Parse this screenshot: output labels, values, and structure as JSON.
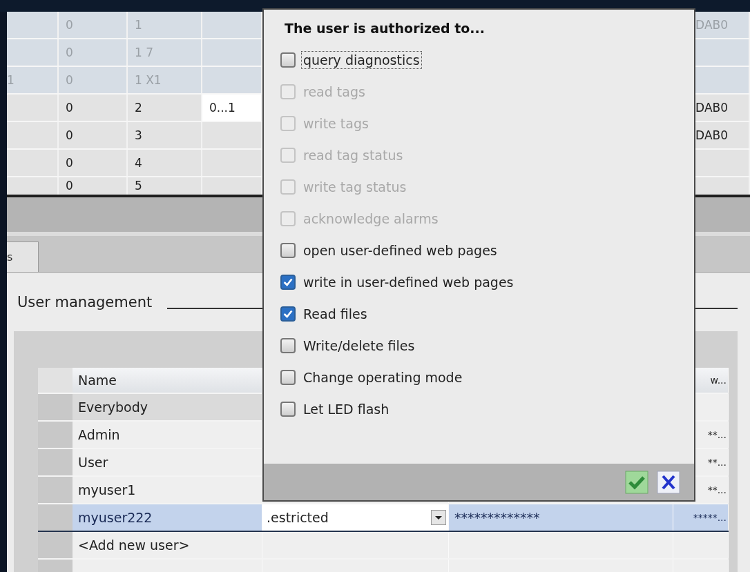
{
  "top_table": {
    "rows": [
      {
        "dimmed": true,
        "cells": [
          "",
          "0",
          "1",
          "",
          "DAB0"
        ]
      },
      {
        "dimmed": true,
        "cells": [
          "",
          "0",
          "1 7",
          "",
          ""
        ]
      },
      {
        "dimmed": true,
        "cells": [
          "1",
          "0",
          "1 X1",
          "",
          ""
        ]
      },
      {
        "dimmed": false,
        "cells": [
          "",
          "0",
          "2",
          "0...1",
          "DAB0"
        ]
      },
      {
        "dimmed": false,
        "cells": [
          "",
          "0",
          "3",
          "",
          "DAB0"
        ]
      },
      {
        "dimmed": false,
        "cells": [
          "",
          "0",
          "4",
          "",
          ""
        ]
      },
      {
        "dimmed": false,
        "cells": [
          "",
          "0",
          "5",
          "",
          ""
        ]
      }
    ]
  },
  "tabs": [
    {
      "label": "s",
      "selected": false
    }
  ],
  "section_title": "User management",
  "user_table": {
    "columns": [
      "Name",
      "w..."
    ],
    "rows": [
      {
        "name": "Everybody",
        "access": "",
        "password": "",
        "column_4": "",
        "selected": false
      },
      {
        "name": "Admin",
        "access": "",
        "password": "",
        "column_4": "**...",
        "selected": false
      },
      {
        "name": "User",
        "access": "",
        "password": "",
        "column_4": "**...",
        "selected": false
      },
      {
        "name": "myuser1",
        "access": "",
        "password": "",
        "column_4": "**...",
        "selected": false
      },
      {
        "name": "myuser222",
        "access": ".estricted",
        "password": "*************",
        "column_4": "*****...",
        "selected": true
      },
      {
        "name": "<Add new user>",
        "access": "",
        "password": "",
        "column_4": "",
        "selected": false
      }
    ]
  },
  "popup": {
    "title": "The user is authorized to...",
    "items": [
      {
        "label": "query diagnostics",
        "checked": false,
        "disabled": false,
        "focused": true
      },
      {
        "label": "read tags",
        "checked": false,
        "disabled": true,
        "focused": false
      },
      {
        "label": "write tags",
        "checked": false,
        "disabled": true,
        "focused": false
      },
      {
        "label": "read tag status",
        "checked": false,
        "disabled": true,
        "focused": false
      },
      {
        "label": "write tag status",
        "checked": false,
        "disabled": true,
        "focused": false
      },
      {
        "label": "acknowledge alarms",
        "checked": false,
        "disabled": true,
        "focused": false
      },
      {
        "label": "open user-defined web pages",
        "checked": false,
        "disabled": false,
        "focused": false
      },
      {
        "label": "write in user-defined web pages",
        "checked": true,
        "disabled": false,
        "focused": false
      },
      {
        "label": "Read files",
        "checked": true,
        "disabled": false,
        "focused": false
      },
      {
        "label": "Write/delete files",
        "checked": false,
        "disabled": false,
        "focused": false
      },
      {
        "label": "Change operating mode",
        "checked": false,
        "disabled": false,
        "focused": false
      },
      {
        "label": "Let LED flash",
        "checked": false,
        "disabled": false,
        "focused": false
      }
    ]
  }
}
